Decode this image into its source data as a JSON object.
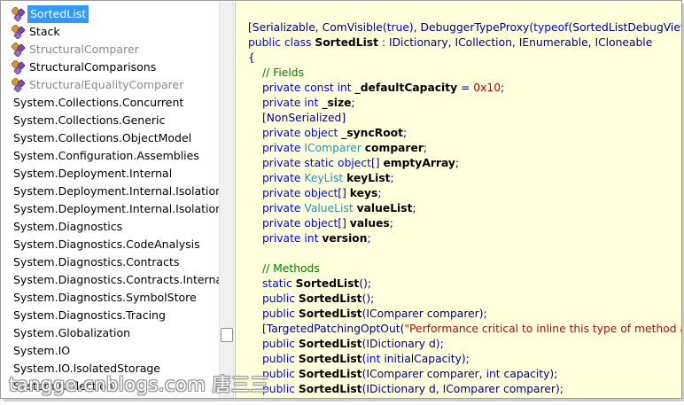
{
  "tree": {
    "items": [
      {
        "label": "SortedList",
        "kind": "class",
        "icon": "class-icon",
        "selected": true,
        "dim": false
      },
      {
        "label": "Stack",
        "kind": "class",
        "icon": "class-icon",
        "selected": false,
        "dim": false
      },
      {
        "label": "StructuralComparer",
        "kind": "class",
        "icon": "class-icon",
        "selected": false,
        "dim": true
      },
      {
        "label": "StructuralComparisons",
        "kind": "class",
        "icon": "class-icon",
        "selected": false,
        "dim": false
      },
      {
        "label": "StructuralEqualityComparer",
        "kind": "class",
        "icon": "class-icon",
        "selected": false,
        "dim": true
      },
      {
        "label": "System.Collections.Concurrent",
        "kind": "namespace",
        "selected": false,
        "dim": false
      },
      {
        "label": "System.Collections.Generic",
        "kind": "namespace",
        "selected": false,
        "dim": false
      },
      {
        "label": "System.Collections.ObjectModel",
        "kind": "namespace",
        "selected": false,
        "dim": false
      },
      {
        "label": "System.Configuration.Assemblies",
        "kind": "namespace",
        "selected": false,
        "dim": false
      },
      {
        "label": "System.Deployment.Internal",
        "kind": "namespace",
        "selected": false,
        "dim": false
      },
      {
        "label": "System.Deployment.Internal.Isolation",
        "kind": "namespace",
        "selected": false,
        "dim": false
      },
      {
        "label": "System.Deployment.Internal.Isolation.Ma",
        "kind": "namespace",
        "selected": false,
        "dim": false
      },
      {
        "label": "System.Diagnostics",
        "kind": "namespace",
        "selected": false,
        "dim": false
      },
      {
        "label": "System.Diagnostics.CodeAnalysis",
        "kind": "namespace",
        "selected": false,
        "dim": false
      },
      {
        "label": "System.Diagnostics.Contracts",
        "kind": "namespace",
        "selected": false,
        "dim": false
      },
      {
        "label": "System.Diagnostics.Contracts.Internal",
        "kind": "namespace",
        "selected": false,
        "dim": false
      },
      {
        "label": "System.Diagnostics.SymbolStore",
        "kind": "namespace",
        "selected": false,
        "dim": false
      },
      {
        "label": "System.Diagnostics.Tracing",
        "kind": "namespace",
        "selected": false,
        "dim": false
      },
      {
        "label": "System.Globalization",
        "kind": "namespace",
        "selected": false,
        "dim": false
      },
      {
        "label": "System.IO",
        "kind": "namespace",
        "selected": false,
        "dim": false
      },
      {
        "label": "System.IO.IsolatedStorage",
        "kind": "namespace",
        "selected": false,
        "dim": false
      },
      {
        "label": "System.Reflection",
        "kind": "namespace",
        "selected": false,
        "dim": false
      }
    ]
  },
  "code": {
    "lines": [
      {
        "indent": 0,
        "tokens": [
          [
            "tx",
            "[Serializable, ComVisible("
          ],
          [
            "kw",
            "true"
          ],
          [
            "tx",
            "), DebuggerTypeProxy("
          ],
          [
            "kw",
            "typeof"
          ],
          [
            "tx",
            "(SortedListDebugView)),"
          ]
        ]
      },
      {
        "indent": 0,
        "tokens": [
          [
            "kw",
            "public class "
          ],
          [
            "bd",
            "SortedList"
          ],
          [
            "tx",
            " : IDictionary, ICollection, IEnumerable, ICloneable"
          ]
        ]
      },
      {
        "indent": 0,
        "tokens": [
          [
            "tx",
            "{"
          ]
        ]
      },
      {
        "indent": 1,
        "tokens": [
          [
            "cm",
            "// Fields"
          ]
        ]
      },
      {
        "indent": 1,
        "tokens": [
          [
            "kw",
            "private const int "
          ],
          [
            "bd",
            "_defaultCapacity"
          ],
          [
            "tx",
            " = "
          ],
          [
            "nm",
            "0x10"
          ],
          [
            "tx",
            ";"
          ]
        ]
      },
      {
        "indent": 1,
        "tokens": [
          [
            "kw",
            "private int "
          ],
          [
            "bd",
            "_size"
          ],
          [
            "tx",
            ";"
          ]
        ]
      },
      {
        "indent": 1,
        "tokens": [
          [
            "tx",
            "[NonSerialized]"
          ]
        ]
      },
      {
        "indent": 1,
        "tokens": [
          [
            "kw",
            "private object "
          ],
          [
            "bd",
            "_syncRoot"
          ],
          [
            "tx",
            ";"
          ]
        ]
      },
      {
        "indent": 1,
        "tokens": [
          [
            "kw",
            "private "
          ],
          [
            "ty",
            "IComparer "
          ],
          [
            "bd",
            "comparer"
          ],
          [
            "tx",
            ";"
          ]
        ]
      },
      {
        "indent": 1,
        "tokens": [
          [
            "kw",
            "private static object"
          ],
          [
            "tx",
            "[] "
          ],
          [
            "bd",
            "emptyArray"
          ],
          [
            "tx",
            ";"
          ]
        ]
      },
      {
        "indent": 1,
        "tokens": [
          [
            "kw",
            "private "
          ],
          [
            "ty",
            "KeyList "
          ],
          [
            "bd",
            "keyList"
          ],
          [
            "tx",
            ";"
          ]
        ]
      },
      {
        "indent": 1,
        "tokens": [
          [
            "kw",
            "private object"
          ],
          [
            "tx",
            "[] "
          ],
          [
            "bd",
            "keys"
          ],
          [
            "tx",
            ";"
          ]
        ]
      },
      {
        "indent": 1,
        "tokens": [
          [
            "kw",
            "private "
          ],
          [
            "ty",
            "ValueList "
          ],
          [
            "bd",
            "valueList"
          ],
          [
            "tx",
            ";"
          ]
        ]
      },
      {
        "indent": 1,
        "tokens": [
          [
            "kw",
            "private object"
          ],
          [
            "tx",
            "[] "
          ],
          [
            "bd",
            "values"
          ],
          [
            "tx",
            ";"
          ]
        ]
      },
      {
        "indent": 1,
        "tokens": [
          [
            "kw",
            "private int "
          ],
          [
            "bd",
            "version"
          ],
          [
            "tx",
            ";"
          ]
        ]
      },
      {
        "indent": 0,
        "tokens": []
      },
      {
        "indent": 1,
        "tokens": [
          [
            "cm",
            "// Methods"
          ]
        ]
      },
      {
        "indent": 1,
        "tokens": [
          [
            "kw",
            "static "
          ],
          [
            "bd",
            "SortedList"
          ],
          [
            "tx",
            "();"
          ]
        ]
      },
      {
        "indent": 1,
        "tokens": [
          [
            "kw",
            "public "
          ],
          [
            "bd",
            "SortedList"
          ],
          [
            "tx",
            "();"
          ]
        ]
      },
      {
        "indent": 1,
        "tokens": [
          [
            "kw",
            "public "
          ],
          [
            "bd",
            "SortedList"
          ],
          [
            "tx",
            "(IComparer comparer);"
          ]
        ]
      },
      {
        "indent": 1,
        "tokens": [
          [
            "tx",
            "[TargetedPatchingOptOut("
          ],
          [
            "st",
            "\"Performance critical to inline this type of method acr"
          ]
        ]
      },
      {
        "indent": 1,
        "tokens": [
          [
            "kw",
            "public "
          ],
          [
            "bd",
            "SortedList"
          ],
          [
            "tx",
            "(IDictionary d);"
          ]
        ]
      },
      {
        "indent": 1,
        "tokens": [
          [
            "kw",
            "public "
          ],
          [
            "bd",
            "SortedList"
          ],
          [
            "tx",
            "("
          ],
          [
            "kw",
            "int"
          ],
          [
            "tx",
            " initialCapacity);"
          ]
        ]
      },
      {
        "indent": 1,
        "tokens": [
          [
            "kw",
            "public "
          ],
          [
            "bd",
            "SortedList"
          ],
          [
            "tx",
            "(IComparer comparer, "
          ],
          [
            "kw",
            "int"
          ],
          [
            "tx",
            " capacity);"
          ]
        ]
      },
      {
        "indent": 1,
        "tokens": [
          [
            "kw",
            "public "
          ],
          [
            "bd",
            "SortedList"
          ],
          [
            "tx",
            "(IDictionary d, IComparer comparer);"
          ]
        ]
      }
    ]
  },
  "watermark": "tangge.cnblogs.com 唐三三"
}
